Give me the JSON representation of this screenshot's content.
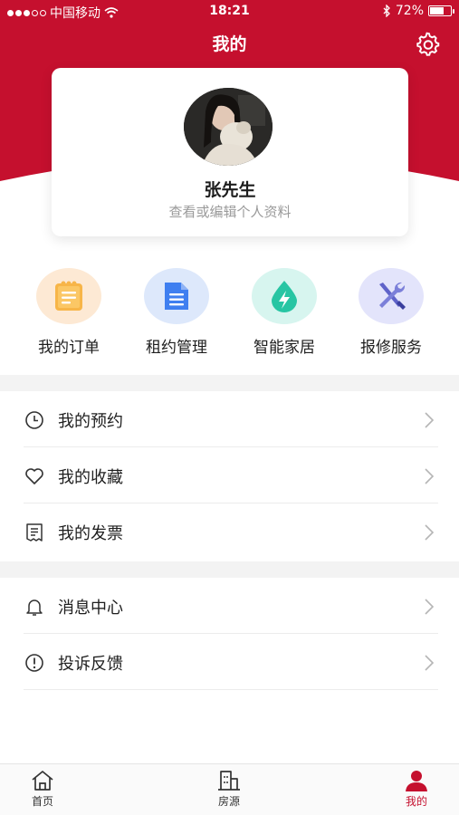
{
  "colors": {
    "brand": "#c5102e",
    "brand_dark": "#b20c28",
    "text": "#1f1f1f",
    "muted": "#9a9a9a"
  },
  "status_bar": {
    "carrier": "中国移动",
    "time": "18:21",
    "battery": "72%",
    "battery_level": 0.72
  },
  "header": {
    "title": "我的",
    "settings_icon": "gear-icon"
  },
  "profile": {
    "name": "张先生",
    "subtitle": "查看或编辑个人资料"
  },
  "quick_actions": [
    {
      "label": "我的订单",
      "icon": "clipboard-icon",
      "bg": "#fde9d4",
      "color": "#f5a73b"
    },
    {
      "label": "租约管理",
      "icon": "document-icon",
      "bg": "#dde8fb",
      "color": "#3f7ff0"
    },
    {
      "label": "智能家居",
      "icon": "water-drop-lightning-icon",
      "bg": "#d7f5ef",
      "color": "#27c5a3"
    },
    {
      "label": "报修服务",
      "icon": "wrench-screwdriver-icon",
      "bg": "#e3e4fb",
      "color": "#5f63c9"
    }
  ],
  "menu_group_1": [
    {
      "label": "我的预约",
      "icon": "clock-icon"
    },
    {
      "label": "我的收藏",
      "icon": "heart-icon"
    },
    {
      "label": "我的发票",
      "icon": "receipt-icon"
    }
  ],
  "menu_group_2": [
    {
      "label": "消息中心",
      "icon": "bell-icon"
    },
    {
      "label": "投诉反馈",
      "icon": "exclamation-circle-icon"
    }
  ],
  "tabs": [
    {
      "label": "首页",
      "icon": "home-icon",
      "active": false
    },
    {
      "label": "房源",
      "icon": "building-icon",
      "active": false
    },
    {
      "label": "我的",
      "icon": "user-icon",
      "active": true
    }
  ]
}
